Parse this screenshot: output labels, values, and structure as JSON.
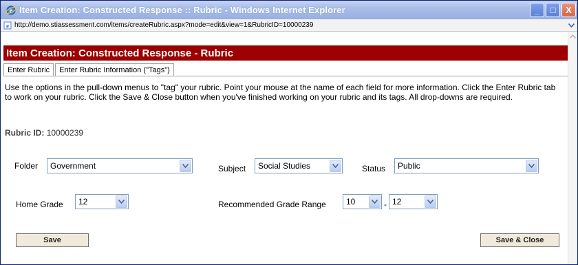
{
  "window": {
    "title": "Item Creation: Constructed Response :: Rubric - Windows Internet Explorer",
    "minimize_glyph": "_",
    "maximize_glyph": "□",
    "close_glyph": "X"
  },
  "address": {
    "url": "http://demo.stiassessment.com/items/createRubric.aspx?mode=edit&view=1&RubricID=10000239"
  },
  "page": {
    "header": "Item Creation: Constructed Response - Rubric",
    "tabs": [
      {
        "label": "Enter Rubric",
        "active": false
      },
      {
        "label": "Enter Rubric Information (\"Tags\")",
        "active": true
      }
    ],
    "instructions": "Use the options in the pull-down menus to \"tag\" your rubric. Point your mouse at the name of each field for more information. Click the Enter Rubric tab to work on your rubric. Click the Save & Close button when you've finished working on your rubric and its tags. All drop-downs are required.",
    "rubric_id_label": "Rubric ID:",
    "rubric_id_value": "10000239"
  },
  "form": {
    "folder_label": "Folder",
    "folder_value": "Government",
    "subject_label": "Subject",
    "subject_value": "Social Studies",
    "status_label": "Status",
    "status_value": "Public",
    "home_grade_label": "Home Grade",
    "home_grade_value": "12",
    "grade_range_label": "Recommended Grade Range",
    "grade_range_from": "10",
    "grade_range_separator": "-",
    "grade_range_to": "12"
  },
  "buttons": {
    "save": "Save",
    "save_close": "Save & Close"
  }
}
